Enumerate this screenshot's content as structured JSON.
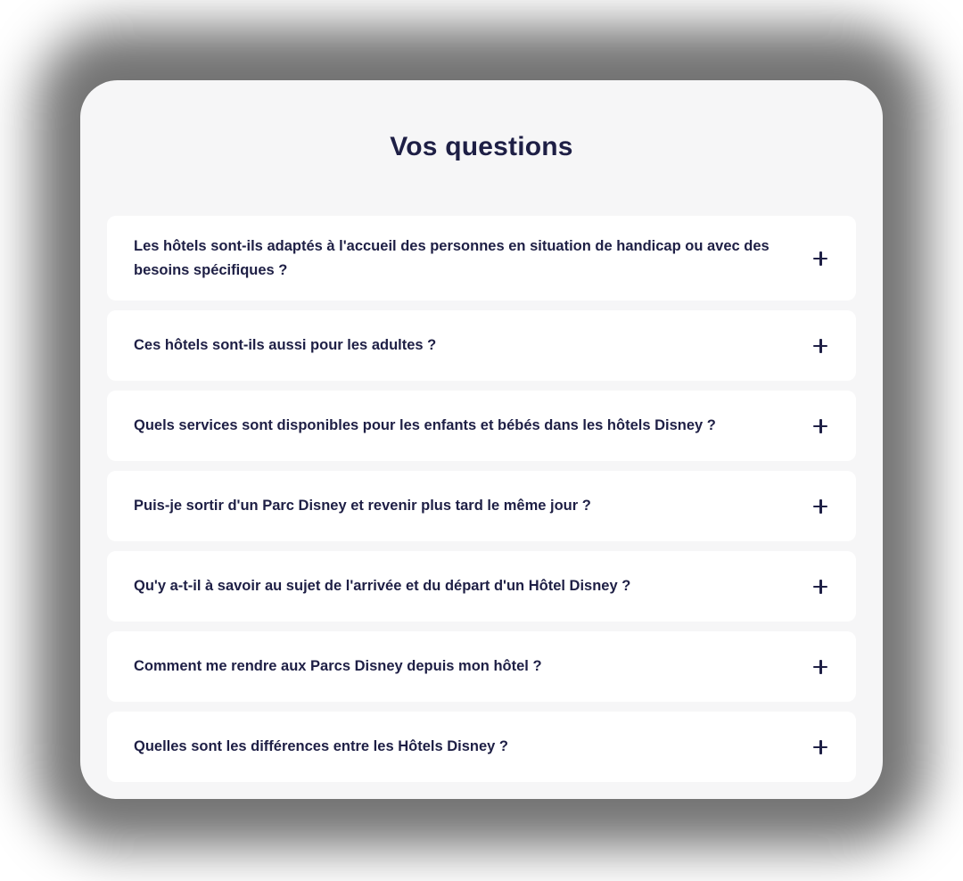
{
  "section": {
    "title": "Vos questions"
  },
  "faq": {
    "items": [
      {
        "question": "Les hôtels sont-ils adaptés à l'accueil des personnes en situation de handicap ou avec des besoins spécifiques ?",
        "expanded": false,
        "toggle_icon": "plus-icon"
      },
      {
        "question": "Ces hôtels sont-ils aussi pour les adultes ?",
        "expanded": false,
        "toggle_icon": "plus-icon"
      },
      {
        "question": "Quels services sont disponibles pour les enfants et bébés dans les hôtels Disney ?",
        "expanded": false,
        "toggle_icon": "plus-icon"
      },
      {
        "question": "Puis-je sortir d'un Parc Disney et revenir plus tard le même jour ?",
        "expanded": false,
        "toggle_icon": "plus-icon"
      },
      {
        "question": "Qu'y a-t-il à savoir au sujet de l'arrivée et du départ d'un Hôtel Disney ?",
        "expanded": false,
        "toggle_icon": "plus-icon"
      },
      {
        "question": "Comment me rendre aux Parcs Disney depuis mon hôtel ?",
        "expanded": false,
        "toggle_icon": "plus-icon"
      },
      {
        "question": "Quelles sont les différences entre les Hôtels Disney ?",
        "expanded": false,
        "toggle_icon": "plus-icon"
      }
    ]
  },
  "colors": {
    "text": "#1e1f45",
    "panel_background": "#f6f6f7",
    "card_background": "#ffffff"
  }
}
